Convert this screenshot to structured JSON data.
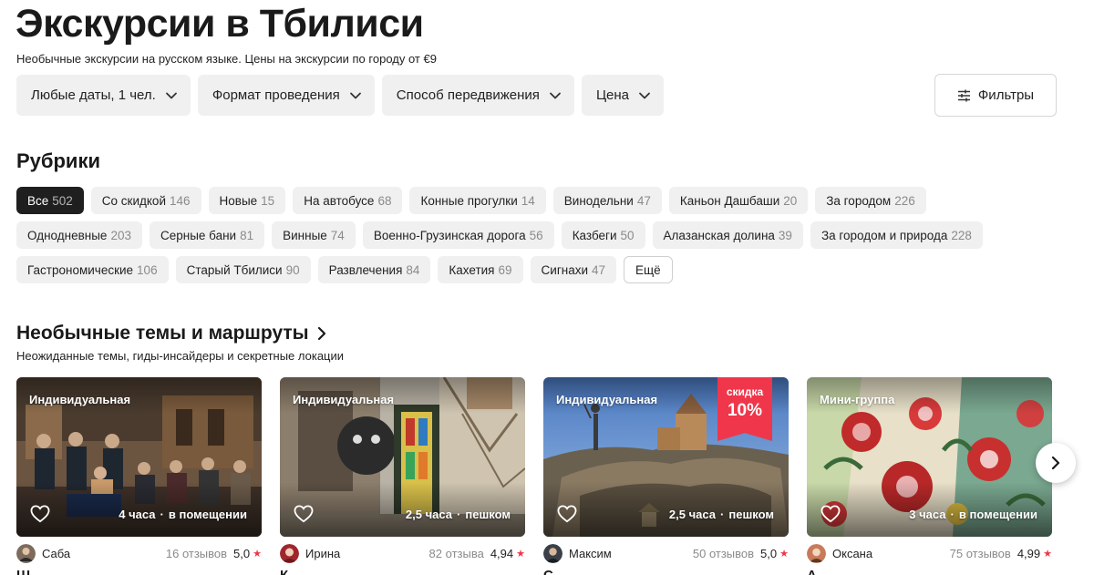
{
  "page": {
    "title": "Экскурсии в Тбилиси",
    "subtitle": "Необычные экскурсии на русском языке. Цены на экскурсии по городу от €9"
  },
  "filters": [
    {
      "label": "Любые даты, 1 чел."
    },
    {
      "label": "Формат проведения"
    },
    {
      "label": "Способ передвижения"
    },
    {
      "label": "Цена"
    }
  ],
  "filters_button": {
    "label": "Фильтры",
    "icon": "sliders-icon"
  },
  "rubrics": {
    "title": "Рубрики",
    "rows": [
      [
        {
          "label": "Все",
          "count": "502",
          "active": true
        },
        {
          "label": "Со скидкой",
          "count": "146"
        },
        {
          "label": "Новые",
          "count": "15"
        },
        {
          "label": "На автобусе",
          "count": "68"
        },
        {
          "label": "Конные прогулки",
          "count": "14"
        },
        {
          "label": "Винодельни",
          "count": "47"
        },
        {
          "label": "Каньон Дашбаши",
          "count": "20"
        },
        {
          "label": "За городом",
          "count": "226"
        }
      ],
      [
        {
          "label": "Однодневные",
          "count": "203"
        },
        {
          "label": "Серные бани",
          "count": "81"
        },
        {
          "label": "Винные",
          "count": "74"
        },
        {
          "label": "Военно-Грузинская дорога",
          "count": "56"
        },
        {
          "label": "Казбеги",
          "count": "50"
        },
        {
          "label": "Алазанская долина",
          "count": "39"
        },
        {
          "label": "За городом и природа",
          "count": "228"
        }
      ],
      [
        {
          "label": "Гастрономические",
          "count": "106"
        },
        {
          "label": "Старый Тбилиси",
          "count": "90"
        },
        {
          "label": "Развлечения",
          "count": "84"
        },
        {
          "label": "Кахетия",
          "count": "69"
        },
        {
          "label": "Сигнахи",
          "count": "47"
        }
      ]
    ],
    "more_label": "Ещё"
  },
  "themes": {
    "title": "Необычные темы и маршруты",
    "subtitle": "Неожиданные темы, гиды-инсайдеры и секретные локации",
    "cards": [
      {
        "format": "Индивидуальная",
        "duration": "4 часа",
        "mode": "в помещении",
        "guide": "Саба",
        "reviews": "16 отзывов",
        "rating": "5,0",
        "title": "Ш",
        "discount": null
      },
      {
        "format": "Индивидуальная",
        "duration": "2,5 часа",
        "mode": "пешком",
        "guide": "Ирина",
        "reviews": "82 отзыва",
        "rating": "4,94",
        "title": "К",
        "discount": null
      },
      {
        "format": "Индивидуальная",
        "duration": "2,5 часа",
        "mode": "пешком",
        "guide": "Максим",
        "reviews": "50 отзывов",
        "rating": "5,0",
        "title": "С",
        "discount": {
          "label": "скидка",
          "value": "10%"
        }
      },
      {
        "format": "Мини-группа",
        "duration": "3 часа",
        "mode": "в помещении",
        "guide": "Оксана",
        "reviews": "75 отзывов",
        "rating": "4,99",
        "title": "А",
        "discount": null
      }
    ]
  },
  "colors": {
    "accent": "#f0364a",
    "chip_bg": "#f0f0f0",
    "chip_active": "#1f1f1f"
  }
}
